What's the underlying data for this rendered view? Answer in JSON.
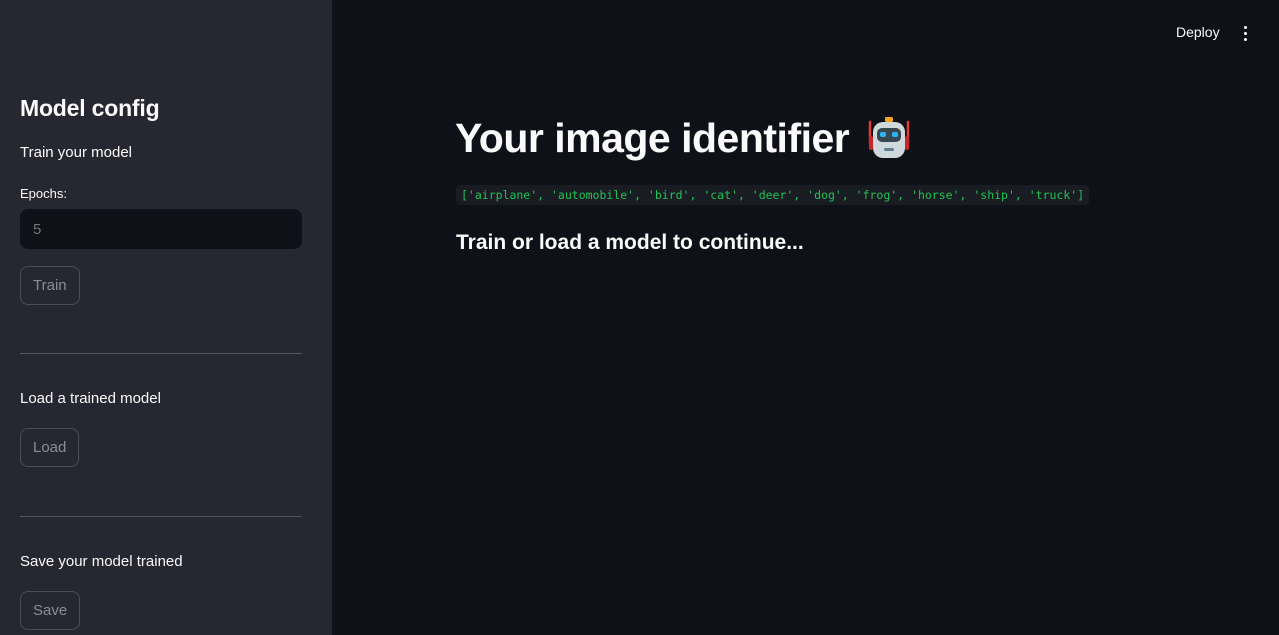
{
  "sidebar": {
    "title": "Model config",
    "train_section_text": "Train your model",
    "epochs_label": "Epochs:",
    "epochs_placeholder": "5",
    "train_button": "Train",
    "load_section_text": "Load a trained model",
    "load_button": "Load",
    "save_section_text": "Save your model trained",
    "save_button": "Save"
  },
  "topbar": {
    "deploy_label": "Deploy",
    "menu_icon": "kebab-menu-icon"
  },
  "main": {
    "title": "Your image identifier",
    "title_icon": "robot-icon",
    "classes_code": "['airplane', 'automobile', 'bird', 'cat', 'deer', 'dog', 'frog', 'horse', 'ship', 'truck']",
    "status_message": "Train or load a model to continue..."
  },
  "colors": {
    "sidebar_bg": "#262730",
    "main_bg": "#0e1117",
    "code_text": "#21c354",
    "text": "#fafafa"
  }
}
